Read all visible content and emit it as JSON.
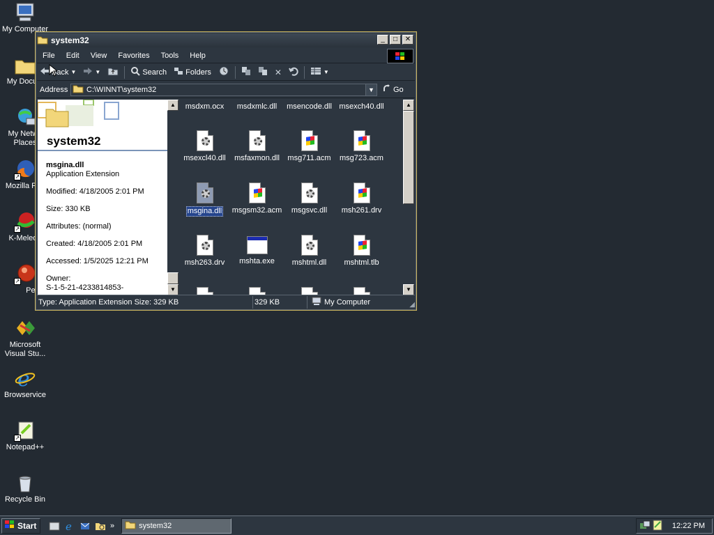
{
  "desktop": {
    "icons": [
      {
        "label": "My Computer",
        "icon": "my-computer-icon"
      },
      {
        "label": "My Docum",
        "icon": "my-documents-icon"
      },
      {
        "label": "My Netwo Places",
        "icon": "network-places-icon"
      },
      {
        "label": "Mozilla Fire",
        "icon": "firefox-icon"
      },
      {
        "label": "K-Meleon",
        "icon": "k-meleon-icon"
      },
      {
        "label": "Pego",
        "icon": "pego-icon"
      },
      {
        "label": "Microsoft Visual Stu...",
        "icon": "visual-studio-icon"
      },
      {
        "label": "Browservice",
        "icon": "internet-explorer-icon"
      },
      {
        "label": "Notepad++",
        "icon": "notepad-plus-icon"
      },
      {
        "label": "Recycle Bin",
        "icon": "recycle-bin-icon"
      }
    ]
  },
  "window": {
    "title": "system32",
    "menu": [
      "File",
      "Edit",
      "View",
      "Favorites",
      "Tools",
      "Help"
    ],
    "toolbar": {
      "back": "Back",
      "search": "Search",
      "folders": "Folders"
    },
    "address": {
      "label": "Address",
      "value": "C:\\WINNT\\system32",
      "go": "Go"
    },
    "info_pane": {
      "folder_title": "system32",
      "file_name": "msgina.dll",
      "file_type": "Application Extension",
      "modified": "Modified: 4/18/2005 2:01 PM",
      "size": "Size: 330 KB",
      "attributes": "Attributes: (normal)",
      "created": "Created: 4/18/2005 2:01 PM",
      "accessed": "Accessed: 1/5/2025 12:21 PM",
      "owner_label": "Owner:",
      "owner_value": "S-1-5-21-4233814853-"
    },
    "files": [
      {
        "name": "msdxm.ocx",
        "icon": "gear-file-icon"
      },
      {
        "name": "msdxmlc.dll",
        "icon": "gear-file-icon"
      },
      {
        "name": "msencode.dll",
        "icon": "gear-file-icon"
      },
      {
        "name": "msexch40.dll",
        "icon": "gear-file-icon"
      },
      {
        "name": "msexcl40.dll",
        "icon": "gear-file-icon"
      },
      {
        "name": "msfaxmon.dll",
        "icon": "gear-file-icon"
      },
      {
        "name": "msg711.acm",
        "icon": "windows-file-icon"
      },
      {
        "name": "msg723.acm",
        "icon": "windows-file-icon"
      },
      {
        "name": "msgina.dll",
        "icon": "gear-file-icon",
        "selected": true
      },
      {
        "name": "msgsm32.acm",
        "icon": "windows-file-icon"
      },
      {
        "name": "msgsvc.dll",
        "icon": "gear-file-icon"
      },
      {
        "name": "msh261.drv",
        "icon": "windows-file-icon"
      },
      {
        "name": "msh263.drv",
        "icon": "gear-file-icon"
      },
      {
        "name": "mshta.exe",
        "icon": "application-window-icon"
      },
      {
        "name": "mshtml.dll",
        "icon": "gear-file-icon"
      },
      {
        "name": "mshtml.tlb",
        "icon": "windows-file-icon"
      }
    ],
    "status": {
      "type": "Type: Application Extension Size: 329 KB",
      "size": "329 KB",
      "zone": "My Computer"
    }
  },
  "taskbar": {
    "start": "Start",
    "task": "system32",
    "clock": "12:22 PM"
  },
  "colors": {
    "desktop": "#232a32",
    "window_border": "#c8b25a",
    "selection": "#24448c"
  }
}
